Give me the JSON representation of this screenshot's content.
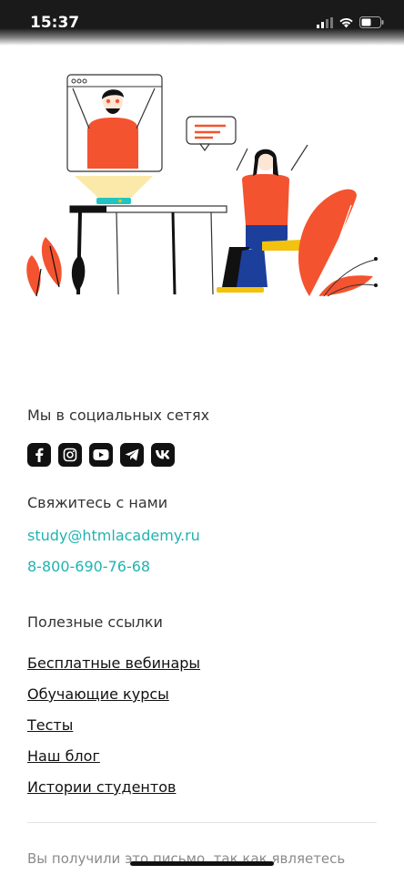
{
  "status_bar": {
    "time": "15:37",
    "icons": [
      "signal-icon",
      "wifi-icon",
      "battery-icon"
    ]
  },
  "illustration": {
    "name": "teacher-student-video-call-illustration",
    "colors": {
      "accent": "#f4532f",
      "yellow": "#f2c20f",
      "blue": "#1c3f9c",
      "teal": "#21c4c0"
    }
  },
  "social": {
    "title": "Мы в социальных сетях",
    "icons": [
      "facebook-icon",
      "instagram-icon",
      "youtube-icon",
      "telegram-icon",
      "vk-icon"
    ]
  },
  "contact": {
    "title": "Свяжитесь с нами",
    "email": "study@htmlacademy.ru",
    "phone": "8-800-690-76-68"
  },
  "useful_links": {
    "title": "Полезные ссылки",
    "items": [
      "Бесплатные вебинары",
      "Обучающие курсы",
      "Тесты",
      "Наш блог",
      "Истории студентов"
    ]
  },
  "footer": {
    "text": "Вы получили это письмо, так как являетесь"
  },
  "colors": {
    "link": "#21b3b0",
    "text": "#333333",
    "muted": "#8b8b8b"
  }
}
